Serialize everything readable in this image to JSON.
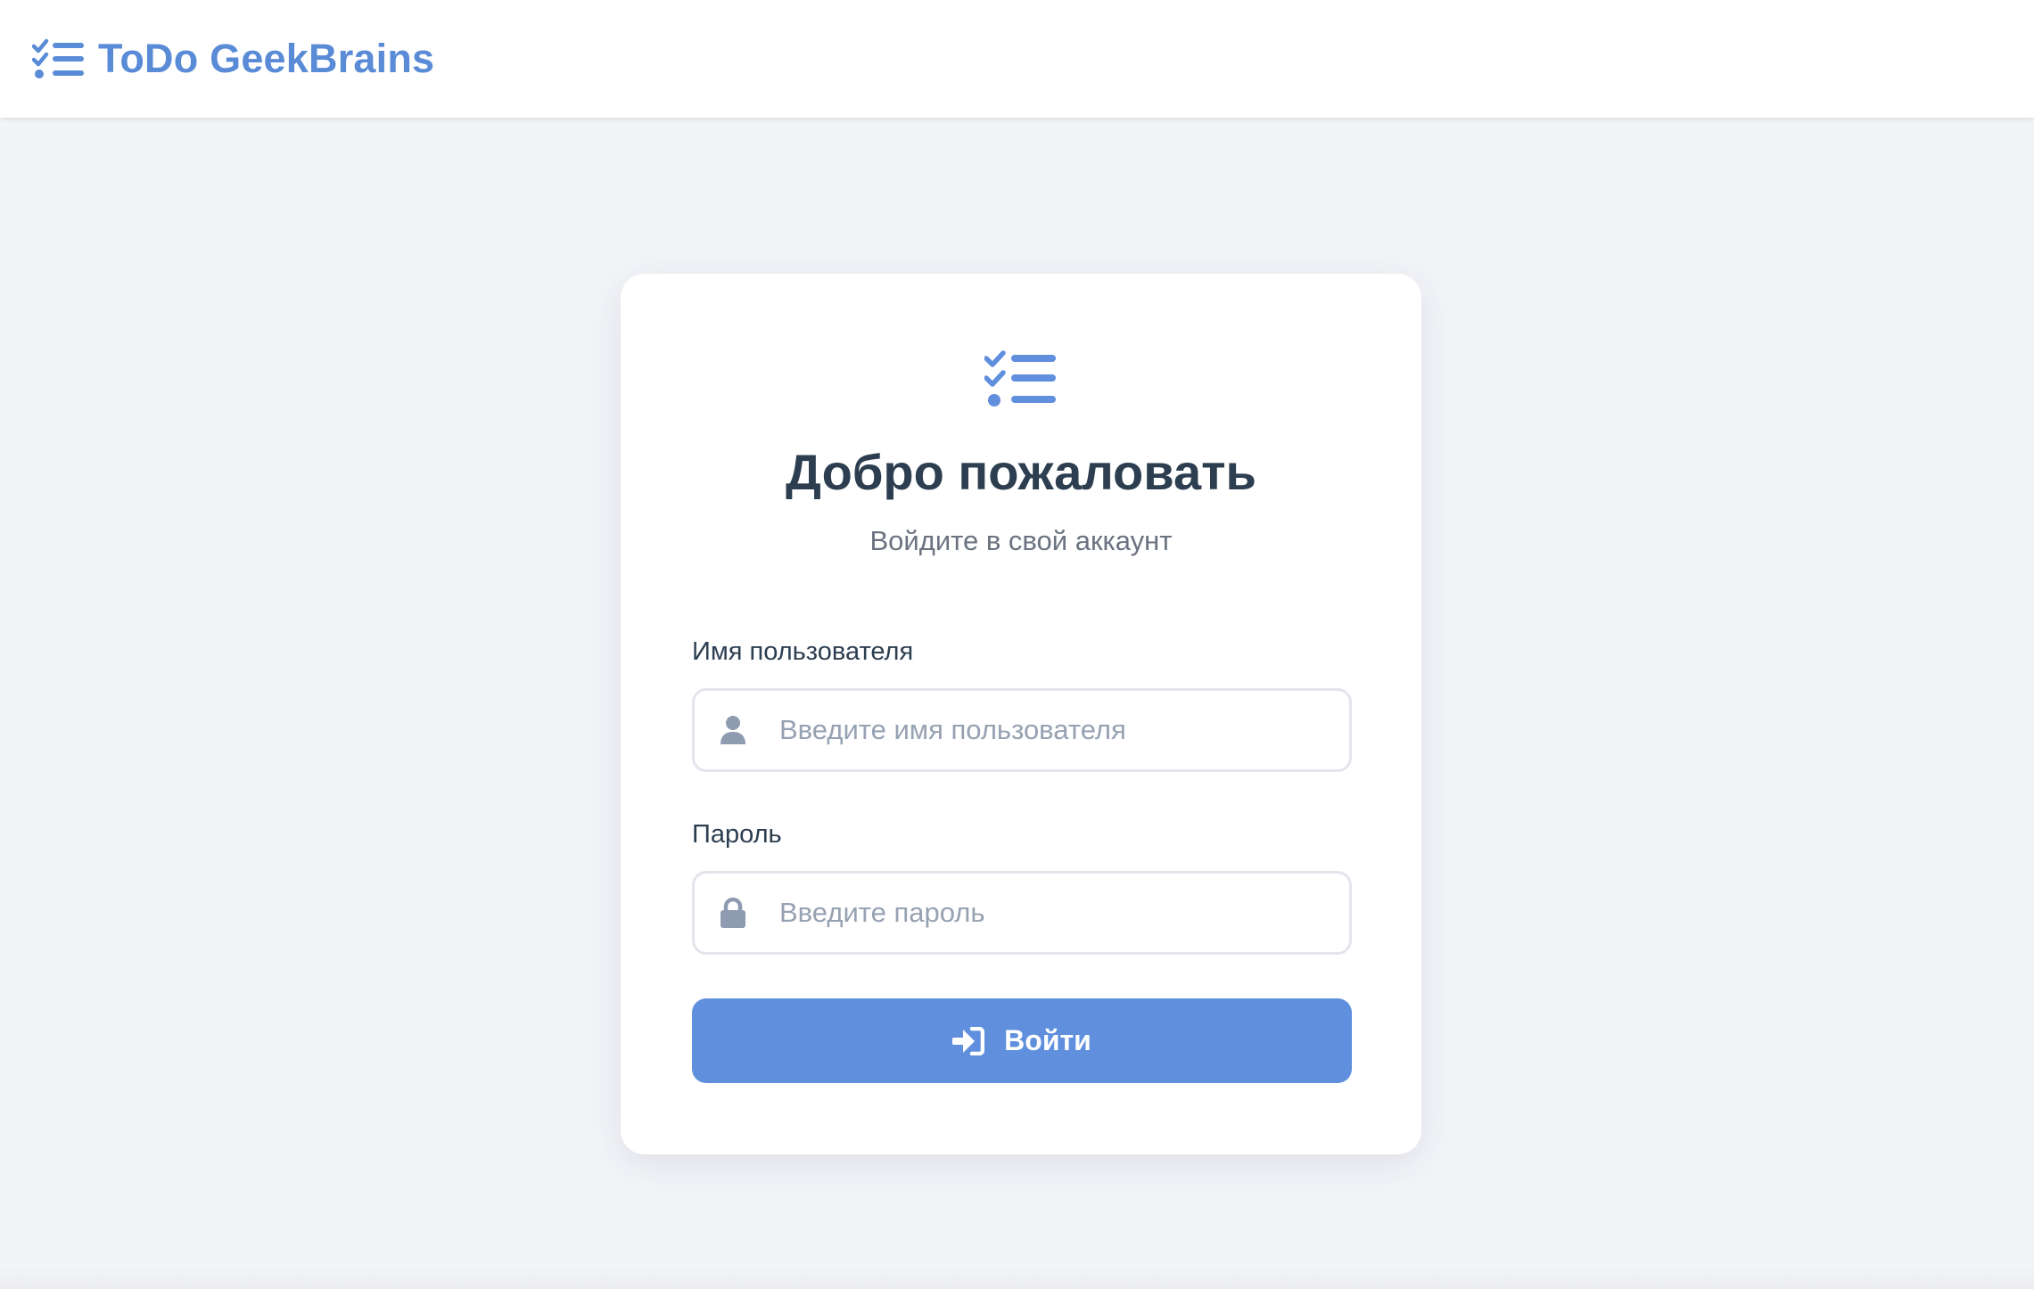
{
  "navbar": {
    "brand_text": "ToDo GeekBrains",
    "brand_icon": "tasks-list-icon"
  },
  "login_card": {
    "icon": "tasks-list-icon",
    "title": "Добро пожаловать",
    "subtitle": "Войдите в свой аккаунт",
    "username": {
      "label": "Имя пользователя",
      "placeholder": "Введите имя пользователя",
      "value": "",
      "icon": "user-icon"
    },
    "password": {
      "label": "Пароль",
      "placeholder": "Введите пароль",
      "value": "",
      "icon": "lock-icon"
    },
    "submit": {
      "label": "Войти",
      "icon": "sign-in-icon"
    }
  },
  "colors": {
    "accent": "#5f8fdd",
    "brand_text": "#5a8bd6",
    "page_background": "#f3f4f8",
    "title_text": "#2c3e50",
    "subtitle_text": "#6b7280",
    "placeholder_text": "#96a1b2",
    "input_icon": "#8e9bb0"
  }
}
